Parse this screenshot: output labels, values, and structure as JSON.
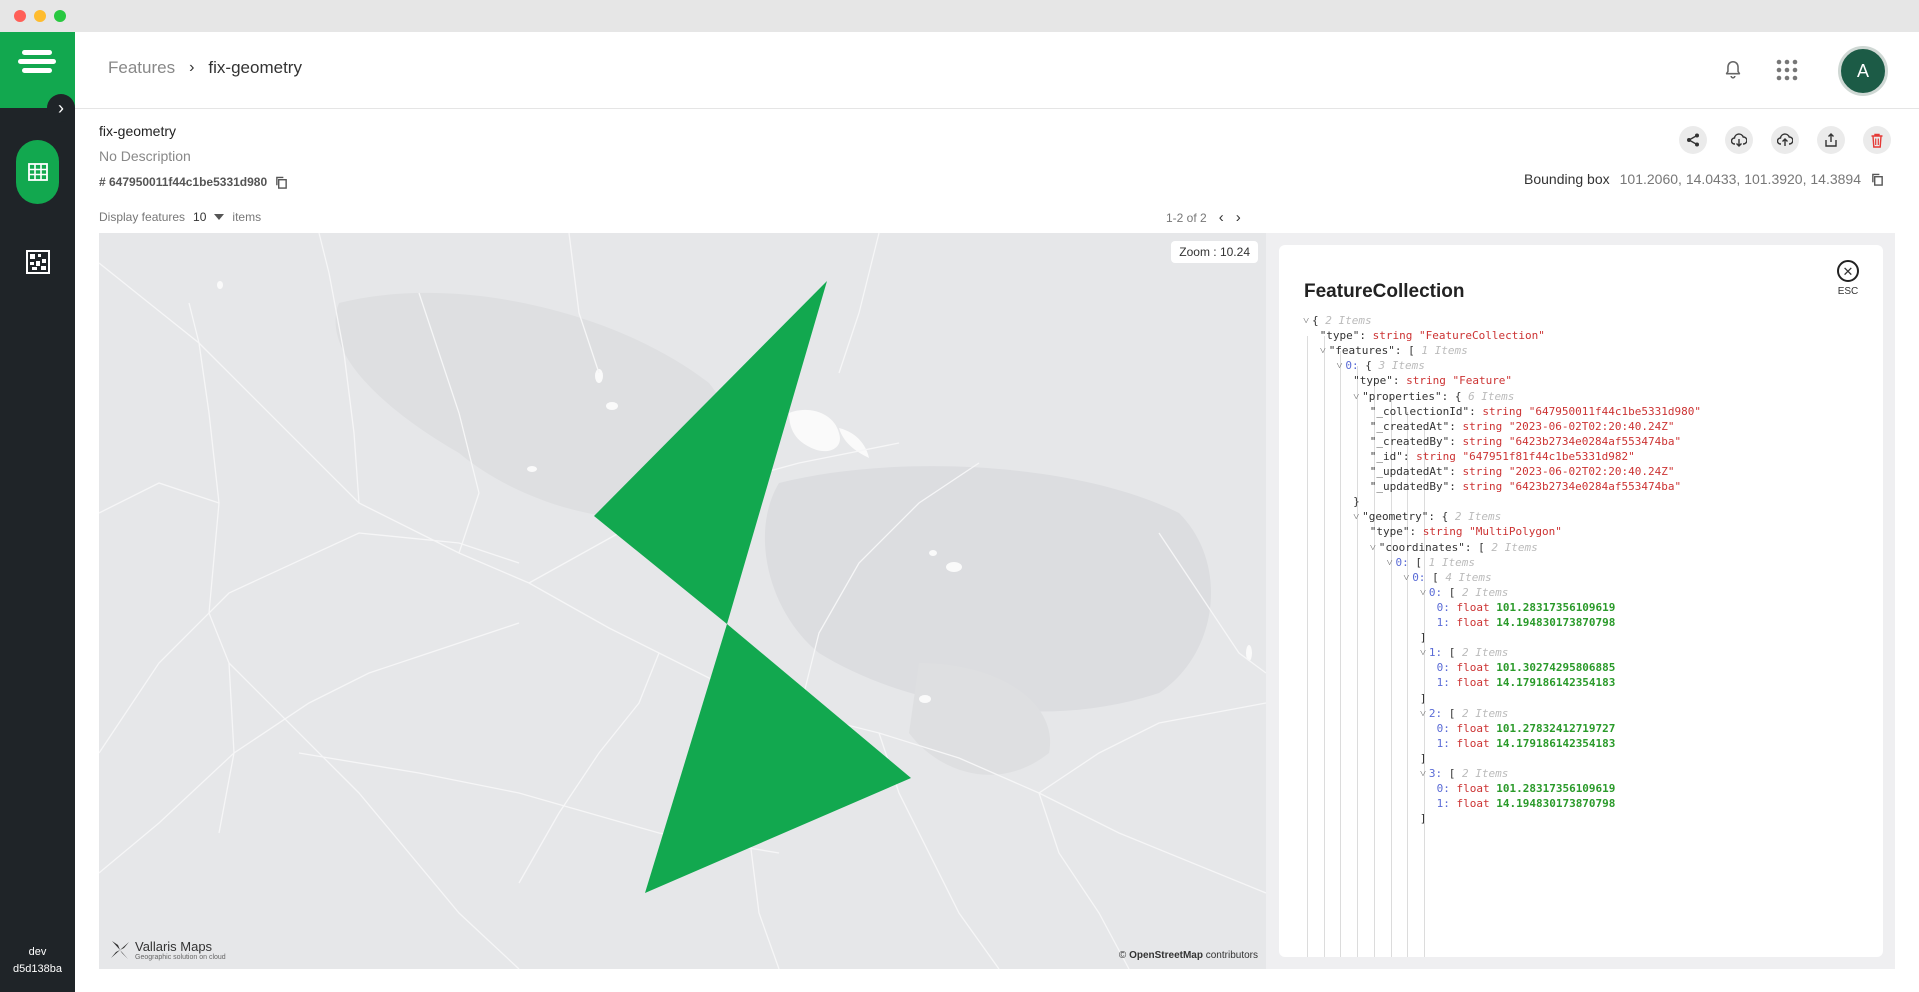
{
  "rail": {
    "footer_env": "dev",
    "footer_hash": "d5d138ba"
  },
  "header": {
    "breadcrumb_parent": "Features",
    "breadcrumb_current": "fix-geometry",
    "avatar_letter": "A"
  },
  "info": {
    "title": "fix-geometry",
    "description": "No Description",
    "id": "# 647950011f44c1be5331d980",
    "bbox_label": "Bounding box",
    "bbox_value": "101.2060, 14.0433, 101.3920, 14.3894"
  },
  "list": {
    "display_label": "Display features",
    "display_count": "10",
    "items_label": "items",
    "pager": "1-2 of 2"
  },
  "map": {
    "zoom": "Zoom : 10.24",
    "attribution_site": "OpenStreetMap",
    "attribution_suffix": " contributors",
    "brand_name": "Vallaris Maps",
    "brand_tag": "Geographic solution on cloud",
    "feature_color": "#12a84f"
  },
  "panel": {
    "title": "FeatureCollection",
    "close_label": "ESC",
    "lines": [
      {
        "d": 0,
        "car": true,
        "key": "",
        "brace": "{",
        "comment": "2 Items"
      },
      {
        "d": 1,
        "key": "\"type\":",
        "type": "string",
        "val": "\"FeatureCollection\"",
        "vcls": "s"
      },
      {
        "d": 1,
        "car": true,
        "key": "\"features\":",
        "brace": "[",
        "comment": "1 Items"
      },
      {
        "d": 2,
        "car": true,
        "key": "0:",
        "brace": "{",
        "comment": "3 Items",
        "idx": true
      },
      {
        "d": 3,
        "key": "\"type\":",
        "type": "string",
        "val": "\"Feature\"",
        "vcls": "s"
      },
      {
        "d": 3,
        "car": true,
        "key": "\"properties\":",
        "brace": "{",
        "comment": "6 Items"
      },
      {
        "d": 4,
        "key": "\"_collectionId\":",
        "type": "string",
        "val": "\"647950011f44c1be5331d980\"",
        "vcls": "s"
      },
      {
        "d": 4,
        "key": "\"_createdAt\":",
        "type": "string",
        "val": "\"2023-06-02T02:20:40.24Z\"",
        "vcls": "s"
      },
      {
        "d": 4,
        "key": "\"_createdBy\":",
        "type": "string",
        "val": "\"6423b2734e0284af553474ba\"",
        "vcls": "s"
      },
      {
        "d": 4,
        "key": "\"_id\":",
        "type": "string",
        "val": "\"647951f81f44c1be5331d982\"",
        "vcls": "s"
      },
      {
        "d": 4,
        "key": "\"_updatedAt\":",
        "type": "string",
        "val": "\"2023-06-02T02:20:40.24Z\"",
        "vcls": "s"
      },
      {
        "d": 4,
        "key": "\"_updatedBy\":",
        "type": "string",
        "val": "\"6423b2734e0284af553474ba\"",
        "vcls": "s"
      },
      {
        "d": 3,
        "key": "",
        "brace": "}"
      },
      {
        "d": 3,
        "car": true,
        "key": "\"geometry\":",
        "brace": "{",
        "comment": "2 Items"
      },
      {
        "d": 4,
        "key": "\"type\":",
        "type": "string",
        "val": "\"MultiPolygon\"",
        "vcls": "s"
      },
      {
        "d": 4,
        "car": true,
        "key": "\"coordinates\":",
        "brace": "[",
        "comment": "2 Items"
      },
      {
        "d": 5,
        "car": true,
        "key": "0:",
        "brace": "[",
        "comment": "1 Items",
        "idx": true
      },
      {
        "d": 6,
        "car": true,
        "key": "0:",
        "brace": "[",
        "comment": "4 Items",
        "idx": true
      },
      {
        "d": 7,
        "car": true,
        "key": "0:",
        "brace": "[",
        "comment": "2 Items",
        "idx": true
      },
      {
        "d": 8,
        "key": "0:",
        "type": "float",
        "val": "101.28317356109619",
        "vcls": "f",
        "idx": true
      },
      {
        "d": 8,
        "key": "1:",
        "type": "float",
        "val": "14.194830173870798",
        "vcls": "f",
        "idx": true
      },
      {
        "d": 7,
        "key": "",
        "brace": "]"
      },
      {
        "d": 7,
        "car": true,
        "key": "1:",
        "brace": "[",
        "comment": "2 Items",
        "idx": true
      },
      {
        "d": 8,
        "key": "0:",
        "type": "float",
        "val": "101.30274295806885",
        "vcls": "f",
        "idx": true
      },
      {
        "d": 8,
        "key": "1:",
        "type": "float",
        "val": "14.179186142354183",
        "vcls": "f",
        "idx": true
      },
      {
        "d": 7,
        "key": "",
        "brace": "]"
      },
      {
        "d": 7,
        "car": true,
        "key": "2:",
        "brace": "[",
        "comment": "2 Items",
        "idx": true
      },
      {
        "d": 8,
        "key": "0:",
        "type": "float",
        "val": "101.27832412719727",
        "vcls": "f",
        "idx": true
      },
      {
        "d": 8,
        "key": "1:",
        "type": "float",
        "val": "14.179186142354183",
        "vcls": "f",
        "idx": true
      },
      {
        "d": 7,
        "key": "",
        "brace": "]"
      },
      {
        "d": 7,
        "car": true,
        "key": "3:",
        "brace": "[",
        "comment": "2 Items",
        "idx": true
      },
      {
        "d": 8,
        "key": "0:",
        "type": "float",
        "val": "101.28317356109619",
        "vcls": "f",
        "idx": true
      },
      {
        "d": 8,
        "key": "1:",
        "type": "float",
        "val": "14.194830173870798",
        "vcls": "f",
        "idx": true
      },
      {
        "d": 7,
        "key": "",
        "brace": "]"
      }
    ]
  }
}
